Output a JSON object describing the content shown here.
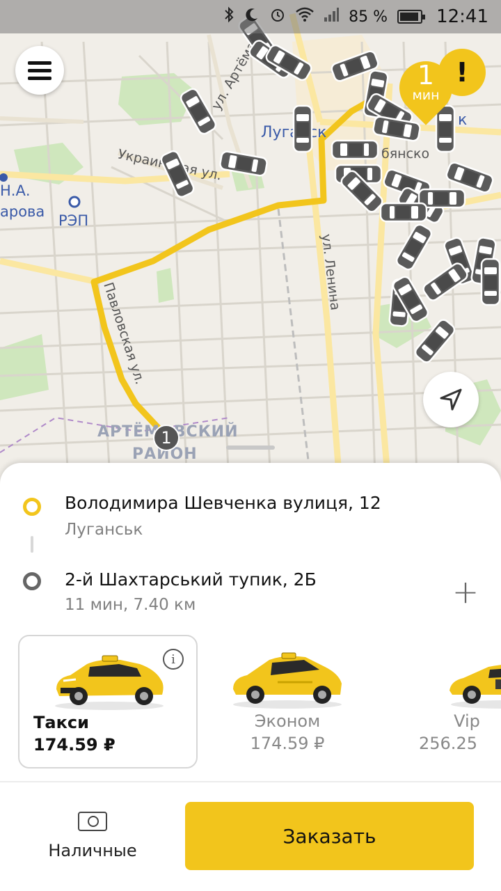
{
  "status_bar": {
    "battery_percent": "85 %",
    "battery_level": 0.85,
    "time": "12:41",
    "icons": [
      "bluetooth-icon",
      "moon-icon",
      "alarm-icon",
      "wifi-icon",
      "signal-icon",
      "battery-icon"
    ]
  },
  "map": {
    "labels": {
      "street_artema": "ул. Артёма",
      "city": "Луганск",
      "street_ukrainskaya": "Украинская ул.",
      "street_lenina": "ул. Ленина",
      "street_pavlovskaya": "Павловская ул.",
      "poi_ocean_prefix": "Н.А.",
      "poi_ocean_name": "арова",
      "poi_rep": "РЭП",
      "district_line1": "АРТЁМОВСКИЙ",
      "district_line2": "РАЙОН",
      "partial_label_a": "к",
      "partial_label_b": "бянско"
    },
    "pickup_eta": {
      "value": "1",
      "unit": "мин"
    },
    "alert_marker": "!",
    "route_pin_label": "1",
    "colors": {
      "accent": "#f2c51c",
      "route": "#f2c51c",
      "car": "#5a5a5a"
    }
  },
  "route": {
    "from": {
      "address": "Володимира Шевченка вулиця, 12",
      "city": "Луганськ"
    },
    "to": {
      "address": "2-й Шахтарський тупик, 2Б",
      "details": "11 мин, 7.40 км"
    },
    "add_stop_label": "+"
  },
  "tariffs": [
    {
      "name": "Такси",
      "price": "174.59 ₽",
      "selected": true,
      "info": "i"
    },
    {
      "name": "Эконом",
      "price": "174.59 ₽",
      "selected": false
    },
    {
      "name": "Vip",
      "price": "256.25",
      "selected": false
    }
  ],
  "payment": {
    "label": "Наличные",
    "icon": "cash-icon"
  },
  "order_button": {
    "label": "Заказать"
  }
}
